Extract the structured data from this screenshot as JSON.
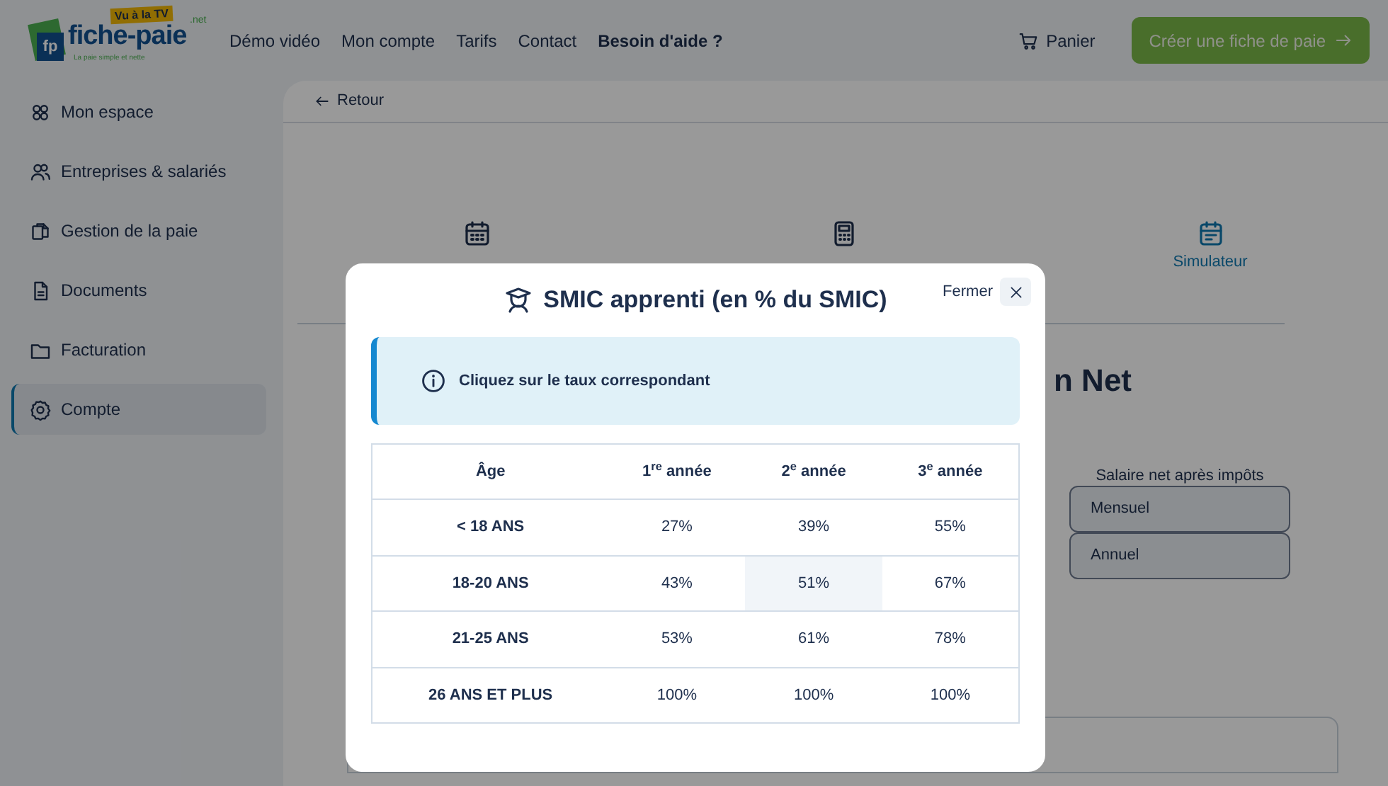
{
  "header": {
    "logo": {
      "mark": "fp",
      "name": "fiche-paie",
      "suffix": ".net",
      "badge": "Vu à la TV",
      "tagline": "La paie simple et nette"
    },
    "nav": [
      {
        "label": "Démo vidéo",
        "bold": false
      },
      {
        "label": "Mon compte",
        "bold": false
      },
      {
        "label": "Tarifs",
        "bold": false
      },
      {
        "label": "Contact",
        "bold": false
      },
      {
        "label": "Besoin d'aide ?",
        "bold": true
      }
    ],
    "cart": "Panier",
    "cta": "Créer une fiche de paie"
  },
  "sidebar": {
    "items": [
      {
        "label": "Mon espace",
        "kind": "grid",
        "selected": false
      },
      {
        "label": "Entreprises & salariés",
        "kind": "users",
        "selected": false
      },
      {
        "label": "Gestion de la paie",
        "kind": "copy",
        "selected": false
      },
      {
        "label": "Documents",
        "kind": "doc",
        "selected": false
      },
      {
        "label": "Facturation",
        "kind": "folder",
        "selected": false
      },
      {
        "label": "Compte",
        "kind": "gear",
        "selected": true
      }
    ]
  },
  "main": {
    "back": "Retour",
    "tabs": [
      {
        "kind": "calendar",
        "selected": false
      },
      {
        "kind": "calculator",
        "selected": false
      },
      {
        "label": "Simulateur",
        "kind": "sheet",
        "selected": true
      }
    ],
    "heading": "n Net",
    "net_label": "Salaire net après impôts",
    "net_buttons": [
      "Mensuel",
      "Annuel"
    ]
  },
  "modal": {
    "title": "SMIC apprenti (en % du SMIC)",
    "close": "Fermer",
    "info": "Cliquez sur le taux correspondant",
    "columns": [
      "Âge",
      "1$^{re}$ année",
      "2$^{e}$ année",
      "3$^{e}$ année"
    ],
    "rows": [
      {
        "age": "< 18 ANS",
        "rates": [
          {
            "value": "27%",
            "selected": false
          },
          {
            "value": "39%",
            "selected": false
          },
          {
            "value": "55%",
            "selected": false
          }
        ]
      },
      {
        "age": "18-20 ANS",
        "rates": [
          {
            "value": "43%",
            "selected": false
          },
          {
            "value": "51%",
            "selected": true
          },
          {
            "value": "67%",
            "selected": false
          }
        ]
      },
      {
        "age": "21-25 ANS",
        "rates": [
          {
            "value": "53%",
            "selected": false
          },
          {
            "value": "61%",
            "selected": false
          },
          {
            "value": "78%",
            "selected": false
          }
        ]
      },
      {
        "age": "26 ANS ET PLUS",
        "rates": [
          {
            "value": "100%",
            "selected": false
          },
          {
            "value": "100%",
            "selected": false
          },
          {
            "value": "100%",
            "selected": false
          }
        ]
      }
    ]
  }
}
